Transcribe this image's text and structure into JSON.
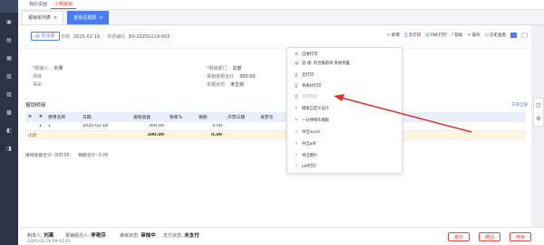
{
  "topnav": {
    "tabs": [
      {
        "label": "我的桌面",
        "active": false
      },
      {
        "label": "小畅报销",
        "active": true
      }
    ]
  },
  "tabs": [
    {
      "label": "报销单列表",
      "active": false
    },
    {
      "label": "查看任报费",
      "active": true
    }
  ],
  "doc": {
    "status": "任信费",
    "date_label": "日期",
    "date": "2025-02-19",
    "no_label": "单据编码",
    "no": "BX-20250219-003"
  },
  "toolbar": {
    "new": "新增",
    "print": "云打印",
    "pdf": "PDF打印",
    "help": "帮助",
    "ops": "操作",
    "more": "历史查看"
  },
  "form": {
    "applicant_label": "报销人",
    "applicant": "刘果",
    "dept_label": "报销部门",
    "dept": "总部",
    "total_label": "报销金额合计",
    "total": "300.00",
    "org_label": "项目",
    "doc_status_label": "单据状态",
    "doc_status": "未生效",
    "reason_label": "事由"
  },
  "detail": {
    "title": "报销明细",
    "right_link": "子表全屏",
    "headers": [
      "",
      "#",
      "费用名称",
      "日期",
      "报销金额",
      "税率%",
      "税额",
      "开票日期",
      "发票号"
    ],
    "rows": [
      [
        "",
        "1",
        "1",
        "2025-02-19",
        "300.00",
        "",
        "0.00",
        "",
        ""
      ]
    ],
    "total_label": "小计",
    "total_amount": "300.00",
    "total_tax": "0.00"
  },
  "summary": {
    "a": "报销金额合计: 300.00",
    "b": "税额合计: 0.00"
  },
  "bottom": {
    "creator_label": "制单人:",
    "creator": "刘果",
    "handler_label": "报销经办人:",
    "handler": "李艳芬",
    "audit_label": "审核状态:",
    "audit": "审核中",
    "pay_label": "支付状态:",
    "pay": "未支付",
    "time": "2025-02-19 09:43:41",
    "btn1": "撤办",
    "btn2": "撤回",
    "btn3": "弃审"
  },
  "dropdown": {
    "items": [
      {
        "icon": "settings-icon",
        "label": "自维打印",
        "gray": false
      },
      {
        "icon": "doc-icon",
        "label": "选 线: 综合报销单 系统预置",
        "gray": false
      },
      {
        "icon": "print-icon",
        "label": "云打印",
        "gray": false
      },
      {
        "icon": "print-icon",
        "label": "系统补打印",
        "gray": false
      },
      {
        "icon": "print-icon",
        "label": "打印预览",
        "gray": true
      },
      {
        "icon": "design-icon",
        "label": "模板自定义设计",
        "gray": false
      },
      {
        "icon": "design-icon",
        "label": "一分钟制作模板",
        "gray": false
      },
      {
        "icon": "export-icon",
        "label": "导出excel",
        "gray": false
      },
      {
        "icon": "export-icon",
        "label": "导出pdf",
        "gray": false
      },
      {
        "icon": "export-icon",
        "label": "导出图片",
        "gray": false
      },
      {
        "icon": "export-icon",
        "label": "pdf打印",
        "gray": false
      }
    ]
  },
  "colors": {
    "accent": "#4a7cf3",
    "danger": "#e24a3b",
    "arrow": "#e0312a"
  }
}
